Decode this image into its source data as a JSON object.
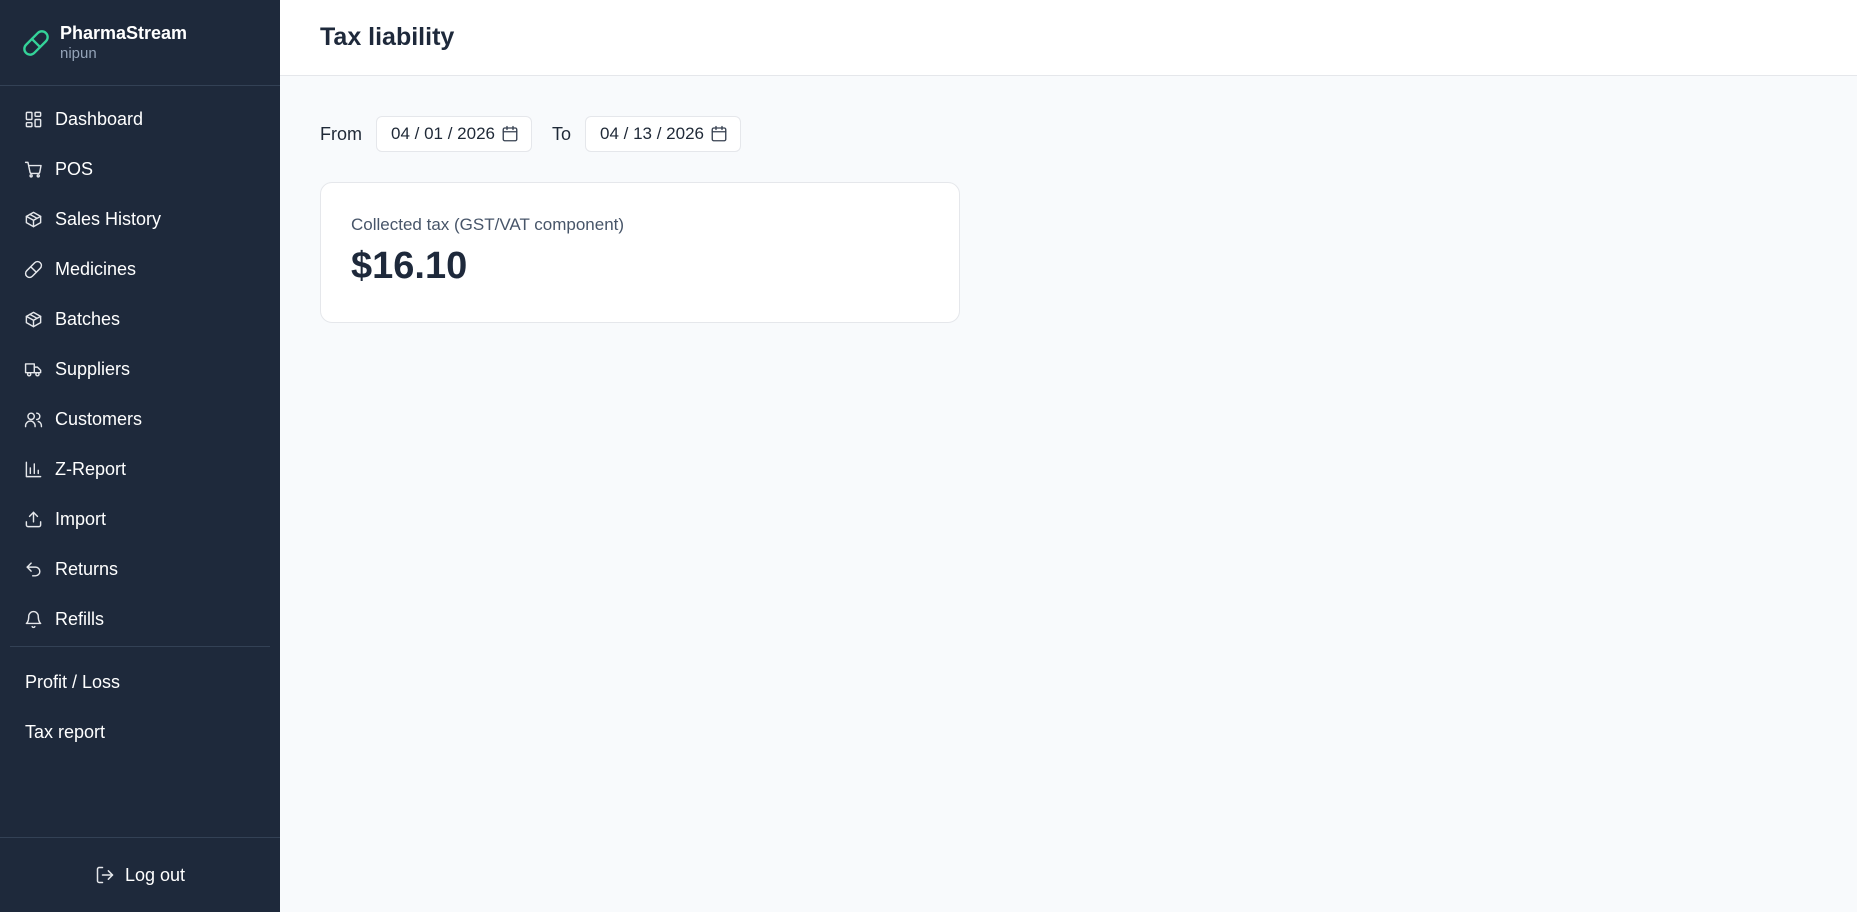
{
  "brand": {
    "name": "PharmaStream",
    "user": "nipun",
    "icon": "pill-icon",
    "accent": "#34d399"
  },
  "sidebar": {
    "items": [
      {
        "label": "Dashboard",
        "icon": "dashboard-icon"
      },
      {
        "label": "POS",
        "icon": "cart-icon"
      },
      {
        "label": "Sales History",
        "icon": "box-icon"
      },
      {
        "label": "Medicines",
        "icon": "pill-icon"
      },
      {
        "label": "Batches",
        "icon": "box-icon"
      },
      {
        "label": "Suppliers",
        "icon": "truck-icon"
      },
      {
        "label": "Customers",
        "icon": "users-icon"
      },
      {
        "label": "Z-Report",
        "icon": "bar-chart-icon"
      },
      {
        "label": "Import",
        "icon": "upload-icon"
      },
      {
        "label": "Returns",
        "icon": "undo-icon"
      },
      {
        "label": "Refills",
        "icon": "bell-icon"
      }
    ],
    "reports": [
      {
        "label": "Profit / Loss"
      },
      {
        "label": "Tax report"
      }
    ],
    "logout_label": "Log out"
  },
  "header": {
    "title": "Tax liability"
  },
  "filters": {
    "from_label": "From",
    "from_value": "04 / 01 / 2026",
    "to_label": "To",
    "to_value": "04 / 13 / 2026"
  },
  "summary": {
    "label": "Collected tax (GST/VAT component)",
    "value": "$16.10"
  },
  "colors": {
    "sidebar_bg": "#1e293b",
    "page_bg": "#f8fafc",
    "text_dark": "#1e293b"
  }
}
